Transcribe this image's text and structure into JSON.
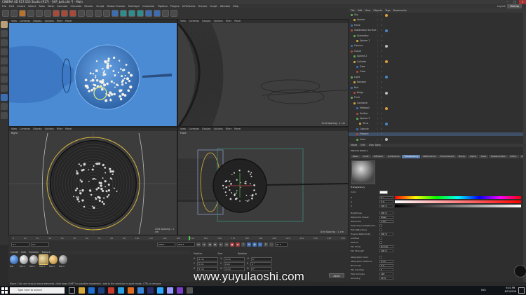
{
  "window": {
    "title": "CINEMA 4D R17.053 Studio (R17) - [VIP_ball.c4d *] - Main"
  },
  "menu": [
    "File",
    "Edit",
    "Create",
    "Select",
    "Tools",
    "Mesh",
    "Animate",
    "Simulate",
    "Render",
    "Sculpt",
    "Motion Tracker",
    "MoGraph",
    "Character",
    "Pipeline",
    "Plugins",
    "X-Particles",
    "Octane",
    "Script",
    "Window",
    "Help"
  ],
  "layout_label": "Layout:",
  "layout_value": "Startup",
  "viewports": {
    "top_left": {
      "menu": [
        "View",
        "Cameras",
        "Display",
        "Options",
        "Filter",
        "Panel"
      ]
    },
    "top_right": {
      "menu": [
        "View",
        "Cameras",
        "Display",
        "Options",
        "Filter",
        "Panel"
      ],
      "footer": "Grid Spacing : 1 cm"
    },
    "bottom_left": {
      "label": "Right",
      "menu": [
        "View",
        "Cameras",
        "Display",
        "Options",
        "Filter",
        "Panel"
      ],
      "footer": "Grid Spacing : 1 cm"
    },
    "bottom_right": {
      "label": "Front",
      "menu": [
        "View",
        "Cameras",
        "Display",
        "Options",
        "Filter",
        "Panel"
      ],
      "footer": "Grid Spacing : 1 cm"
    }
  },
  "timeline": {
    "ticks": [
      "0",
      "10",
      "20",
      "30",
      "40",
      "50",
      "60",
      "70",
      "80",
      "90",
      "100",
      "110",
      "120",
      "130",
      "140",
      "150",
      "160",
      "170",
      "180",
      "190",
      "200",
      "210",
      "220",
      "230",
      "240",
      "250"
    ],
    "start": "0 F",
    "current": "0 F",
    "end": "250 F",
    "end2": "250 F",
    "frame_readout": "91 F"
  },
  "material_manager": {
    "menu": [
      "Create",
      "Edit",
      "Function",
      "Texture"
    ],
    "materials": [
      "Mat",
      "Mat.1",
      "Mat.2",
      "Mat.3",
      "Mat.4",
      "Mat.5"
    ]
  },
  "coordinates": {
    "labels": [
      "Position",
      "Size",
      "Rotation"
    ],
    "rows": [
      [
        "X",
        "0 cm",
        "X",
        "0 cm",
        "H",
        "0 °"
      ],
      [
        "Y",
        "0 cm",
        "Y",
        "0 cm",
        "P",
        "0 °"
      ],
      [
        "Z",
        "0 cm",
        "Z",
        "0 cm",
        "B",
        "0 °"
      ]
    ],
    "modes": [
      "Object (Rel)",
      "Size"
    ],
    "apply": "Apply"
  },
  "object_manager": {
    "menu": [
      "File",
      "Edit",
      "View",
      "Objects",
      "Tags",
      "Bookmarks"
    ],
    "rows": [
      "Sky",
      "Sphere",
      "Plane",
      "Subdivision Surface",
      "Symmetry",
      "Sphere.1",
      "Camera",
      "Cloner",
      "Sphere.2",
      "Cylinder",
      "Tube",
      "Cube",
      "Light",
      "Random",
      "Null",
      "Bulge",
      "Fluid",
      "Container",
      "Metaball",
      "Emitter",
      "Sphere.3",
      "Torus",
      "Capsule",
      "Platonic",
      "Cone"
    ],
    "selected_row": 23
  },
  "attributes": {
    "menu": [
      "Mode",
      "Edit",
      "User Data"
    ],
    "material_label": "Material [Mat.1]",
    "tabs": [
      "Basic",
      "Color",
      "Diffusion",
      "Luminance",
      "Transparency",
      "Reflectance",
      "Environment",
      "Bump",
      "Alpha",
      "Glow",
      "Displacement",
      "Editor",
      "Illumination",
      "Assign"
    ],
    "active_tab": "Transparency",
    "section": "Transparency",
    "fields": [
      "Color",
      "H",
      "S",
      "V",
      "Brightness",
      "Refraction Preset",
      "Refraction",
      "Total Internal Reflection",
      "Exit Reflections",
      "Fresnel Reflectivity",
      "Additive",
      "Texture",
      "Mix Mode",
      "Mix Strength",
      "Absorption Color",
      "Absorption Distance",
      "Blurriness",
      "Min Samples",
      "Max Samples",
      "Accuracy"
    ],
    "values": [
      "",
      "0 °",
      "0 %",
      "100 %",
      "100 %",
      "Glass",
      "1.517",
      "",
      "",
      "100 %",
      "",
      "",
      "Normal",
      "100 %",
      "",
      "0 cm",
      "0 %",
      "5",
      "128",
      "50 %"
    ]
  },
  "statusbar": "Move: Click and drag to move elements. Hold down SHIFT to quantize movement / add to the selection in point mode, CTRL to remove.",
  "taskbar": {
    "search_placeholder": "Type here to search",
    "time": "9:01 PM",
    "date": "8/13/2018",
    "lang": "ENG"
  },
  "watermark": "www.yuyulaoshi.com",
  "colors": {
    "accent_blue": "#4a86c8",
    "viewport_sky": "#4b8bd4",
    "selection": "#3f4f66"
  }
}
